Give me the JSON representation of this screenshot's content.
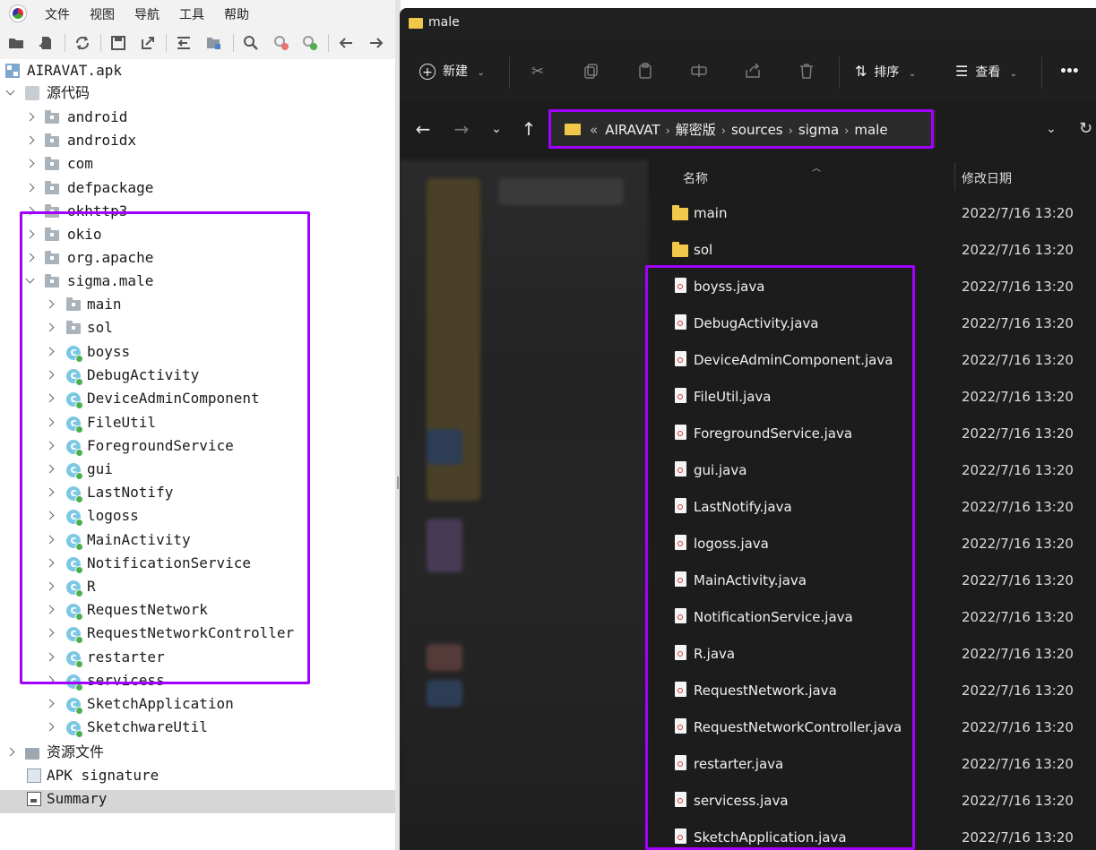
{
  "jadx": {
    "menu": [
      "文件",
      "视图",
      "导航",
      "工具",
      "帮助"
    ],
    "toolbar_icons": [
      "open-folder-icon",
      "add-files-icon",
      "sync-icon",
      "save-icon",
      "export-icon",
      "flatten-icon",
      "package-icon",
      "search-icon",
      "find-class-icon",
      "find-usage-icon",
      "back-icon",
      "forward-icon"
    ],
    "tree": {
      "root": "AIRAVAT.apk",
      "source_code": "源代码",
      "packages": [
        "android",
        "androidx",
        "com",
        "defpackage",
        "okhttp3",
        "okio",
        "org.apache"
      ],
      "expanded_package": "sigma.male",
      "subpackages": [
        "main",
        "sol"
      ],
      "classes": [
        "boyss",
        "DebugActivity",
        "DeviceAdminComponent",
        "FileUtil",
        "ForegroundService",
        "gui",
        "LastNotify",
        "logoss",
        "MainActivity",
        "NotificationService",
        "R",
        "RequestNetwork",
        "RequestNetworkController",
        "restarter",
        "servicess",
        "SketchApplication",
        "SketchwareUtil"
      ],
      "resources": "资源文件",
      "apk_signature": "APK signature",
      "summary": "Summary"
    }
  },
  "explorer": {
    "window_title": "male",
    "toolbar": {
      "new_label": "新建",
      "sort_label": "排序",
      "view_label": "查看",
      "more_label": "•••"
    },
    "breadcrumb_overflow": "«",
    "breadcrumbs": [
      "AIRAVAT",
      "解密版",
      "sources",
      "sigma",
      "male"
    ],
    "columns": {
      "name": "名称",
      "modified": "修改日期"
    },
    "files": [
      {
        "name": "main",
        "date": "2022/7/16 13:20",
        "kind": "folder"
      },
      {
        "name": "sol",
        "date": "2022/7/16 13:20",
        "kind": "folder"
      },
      {
        "name": "boyss.java",
        "date": "2022/7/16 13:20",
        "kind": "java"
      },
      {
        "name": "DebugActivity.java",
        "date": "2022/7/16 13:20",
        "kind": "java"
      },
      {
        "name": "DeviceAdminComponent.java",
        "date": "2022/7/16 13:20",
        "kind": "java"
      },
      {
        "name": "FileUtil.java",
        "date": "2022/7/16 13:20",
        "kind": "java"
      },
      {
        "name": "ForegroundService.java",
        "date": "2022/7/16 13:20",
        "kind": "java"
      },
      {
        "name": "gui.java",
        "date": "2022/7/16 13:20",
        "kind": "java"
      },
      {
        "name": "LastNotify.java",
        "date": "2022/7/16 13:20",
        "kind": "java"
      },
      {
        "name": "logoss.java",
        "date": "2022/7/16 13:20",
        "kind": "java"
      },
      {
        "name": "MainActivity.java",
        "date": "2022/7/16 13:20",
        "kind": "java"
      },
      {
        "name": "NotificationService.java",
        "date": "2022/7/16 13:20",
        "kind": "java"
      },
      {
        "name": "R.java",
        "date": "2022/7/16 13:20",
        "kind": "java"
      },
      {
        "name": "RequestNetwork.java",
        "date": "2022/7/16 13:20",
        "kind": "java"
      },
      {
        "name": "RequestNetworkController.java",
        "date": "2022/7/16 13:20",
        "kind": "java"
      },
      {
        "name": "restarter.java",
        "date": "2022/7/16 13:20",
        "kind": "java"
      },
      {
        "name": "servicess.java",
        "date": "2022/7/16 13:20",
        "kind": "java"
      },
      {
        "name": "SketchApplication.java",
        "date": "2022/7/16 13:20",
        "kind": "java"
      }
    ]
  },
  "colors": {
    "highlight": "#a100ff",
    "folder": "#f2c84b",
    "class_icon": "#7cc8e4"
  }
}
